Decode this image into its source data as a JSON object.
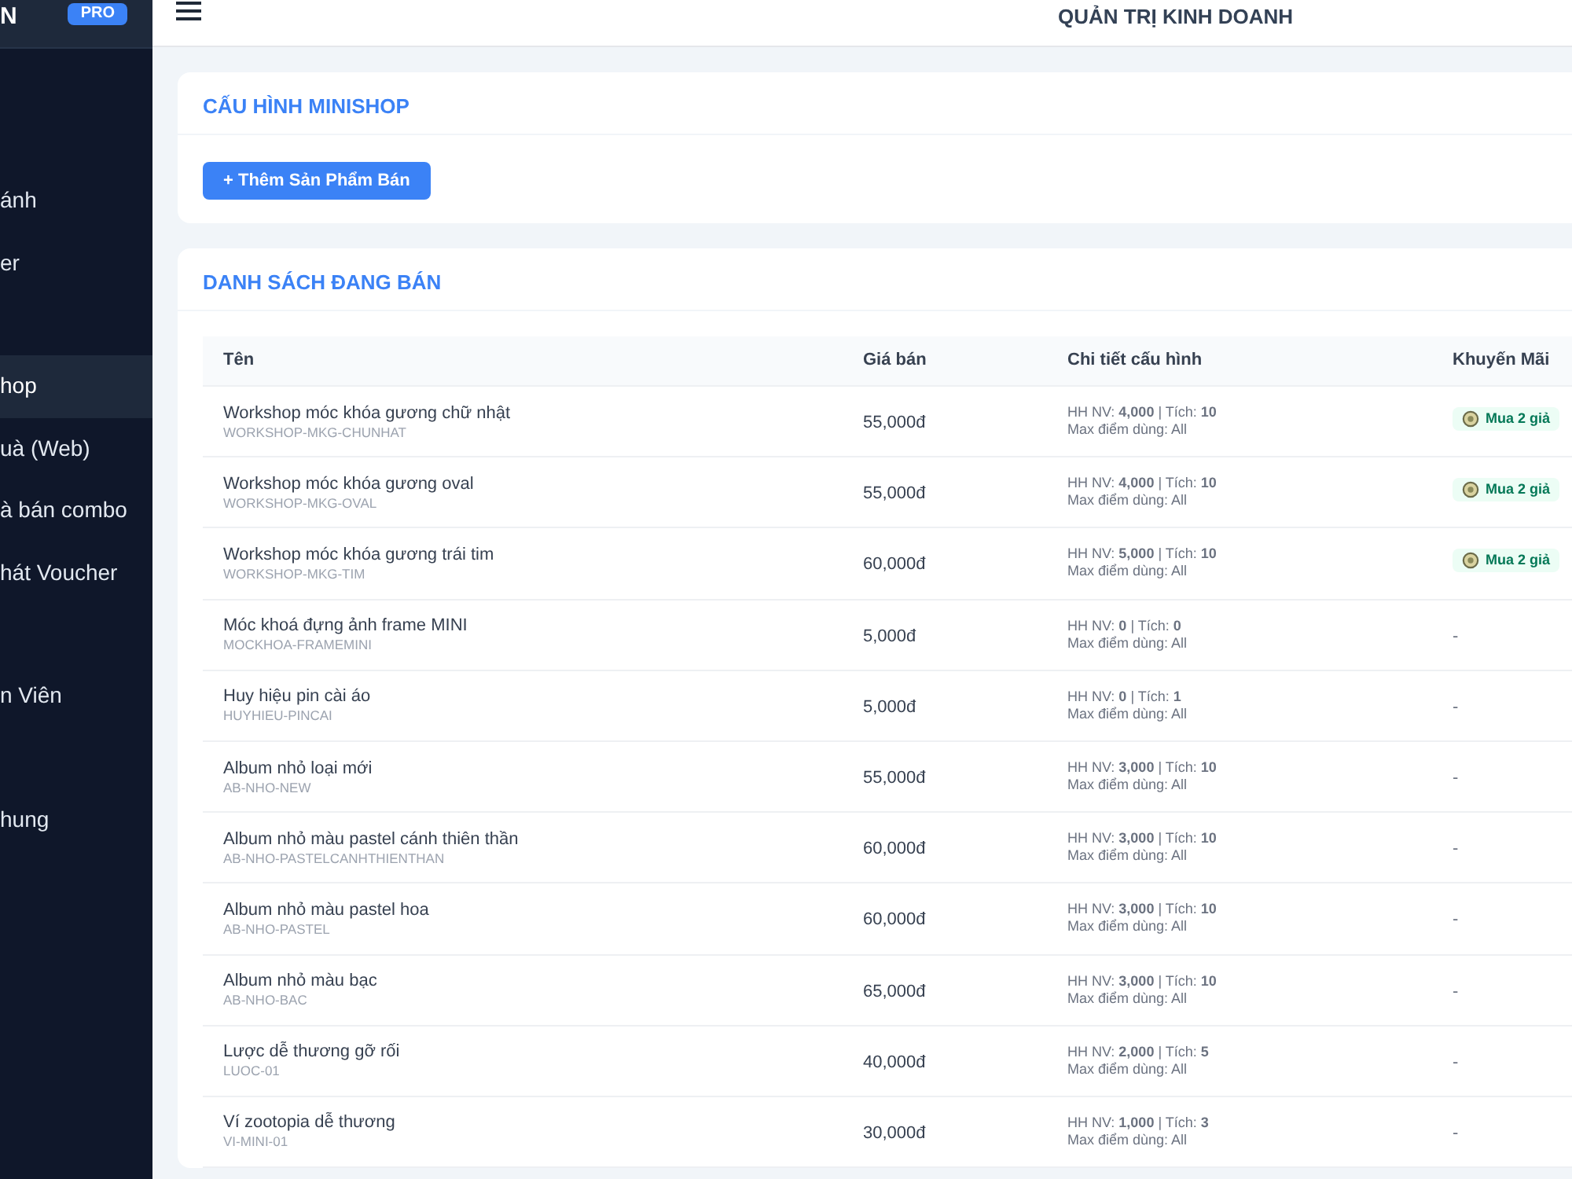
{
  "sidebar": {
    "logo": "N",
    "badge": "PRO",
    "groups": [
      [
        {
          "label": "ánh",
          "selected": false
        },
        {
          "label": "er",
          "selected": false
        }
      ],
      [
        {
          "label": "hop",
          "selected": true
        },
        {
          "label": "uà (Web)",
          "selected": false
        },
        {
          "label": "à bán combo",
          "selected": false
        },
        {
          "label": "hát Voucher",
          "selected": false
        }
      ],
      [
        {
          "label": "n Viên",
          "selected": false
        }
      ],
      [
        {
          "label": "hung",
          "selected": false
        }
      ]
    ]
  },
  "header": {
    "title": "QUẢN TRỊ KINH DOANH"
  },
  "config_card": {
    "title": "CẤU HÌNH MINISHOP",
    "button": "+ Thêm Sản Phẩm Bán"
  },
  "list_card": {
    "title": "DANH SÁCH ĐANG BÁN",
    "table": {
      "columns": [
        "Tên",
        "Giá bán",
        "Chi tiết cấu hình",
        "Khuyến Mãi"
      ],
      "rows": [
        {
          "name": "Workshop móc khóa gương chữ nhật",
          "sku": "WORKSHOP-MKG-CHUNHAT",
          "price": "55,000đ",
          "detail": "HH NV: **4,000** | Tích: **10**",
          "max": "Max điểm dùng: All",
          "promo": "Mua 2 giả"
        },
        {
          "name": "Workshop móc khóa gương oval",
          "sku": "WORKSHOP-MKG-OVAL",
          "price": "55,000đ",
          "detail": "HH NV: **4,000** | Tích: **10**",
          "max": "Max điểm dùng: All",
          "promo": "Mua 2 giả"
        },
        {
          "name": "Workshop móc khóa gương trái tim",
          "sku": "WORKSHOP-MKG-TIM",
          "price": "60,000đ",
          "detail": "HH NV: **5,000** | Tích: **10**",
          "max": "Max điểm dùng: All",
          "promo": "Mua 2 giả"
        },
        {
          "name": "Móc khoá đựng ảnh frame MINI",
          "sku": "MOCKHOA-FRAMEMINI",
          "price": "5,000đ",
          "detail": "HH NV: **0** | Tích: **0**",
          "max": "Max điểm dùng: All",
          "promo_none": "-"
        },
        {
          "name": "Huy hiệu pin cài áo",
          "sku": "HUYHIEU-PINCAI",
          "price": "5,000đ",
          "detail": "HH NV: **0** | Tích: **1**",
          "max": "Max điểm dùng: All",
          "promo_none": "-"
        },
        {
          "name": "Album nhỏ loại mới",
          "sku": "AB-NHO-NEW",
          "price": "55,000đ",
          "detail": "HH NV: **3,000** | Tích: **10**",
          "max": "Max điểm dùng: All",
          "promo_none": "-"
        },
        {
          "name": "Album nhỏ màu pastel cánh thiên thần",
          "sku": "AB-NHO-PASTELCANHTHIENTHAN",
          "price": "60,000đ",
          "detail": "HH NV: **3,000** | Tích: **10**",
          "max": "Max điểm dùng: All",
          "promo_none": "-"
        },
        {
          "name": "Album nhỏ màu pastel hoa",
          "sku": "AB-NHO-PASTEL",
          "price": "60,000đ",
          "detail": "HH NV: **3,000** | Tích: **10**",
          "max": "Max điểm dùng: All",
          "promo_none": "-"
        },
        {
          "name": "Album nhỏ màu bạc",
          "sku": "AB-NHO-BAC",
          "price": "65,000đ",
          "detail": "HH NV: **3,000** | Tích: **10**",
          "max": "Max điểm dùng: All",
          "promo_none": "-"
        },
        {
          "name": "Lược dễ thương gỡ rối",
          "sku": "LUOC-01",
          "price": "40,000đ",
          "detail": "HH NV: **2,000** | Tích: **5**",
          "max": "Max điểm dùng: All",
          "promo_none": "-"
        },
        {
          "name": "Ví zootopia dễ thương",
          "sku": "VI-MINI-01",
          "price": "30,000đ",
          "detail": "HH NV: **1,000** | Tích: **3**",
          "max": "Max điểm dùng: All",
          "promo_none": "-"
        }
      ]
    }
  }
}
